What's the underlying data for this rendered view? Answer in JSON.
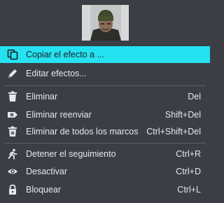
{
  "preview": {
    "thumbnail_icon": "person-thumbnail"
  },
  "menu": {
    "colors": {
      "background": "#3b3f45",
      "highlight": "#25e2f1",
      "text": "#e6e8ea",
      "separator": "#5b6067"
    },
    "items": [
      {
        "label": "Copiar el efecto a ...",
        "shortcut": "",
        "icon": "copy-icon",
        "selected": true
      },
      {
        "label": "Editar efectos...",
        "shortcut": "",
        "icon": "pencil-icon"
      },
      {
        "label": "Eliminar",
        "shortcut": "Del",
        "icon": "trash-icon"
      },
      {
        "label": "Eliminar reenviar",
        "shortcut": "Shift+Del",
        "icon": "delete-forward-icon"
      },
      {
        "label": "Eliminar de todos los marcos",
        "shortcut": "Ctrl+Shift+Del",
        "icon": "trash-all-icon"
      },
      {
        "label": "Detener el seguimiento",
        "shortcut": "Ctrl+R",
        "icon": "running-person-icon"
      },
      {
        "label": "Desactivar",
        "shortcut": "Ctrl+D",
        "icon": "eye-icon"
      },
      {
        "label": "Bloquear",
        "shortcut": "Ctrl+L",
        "icon": "lock-icon"
      }
    ]
  }
}
